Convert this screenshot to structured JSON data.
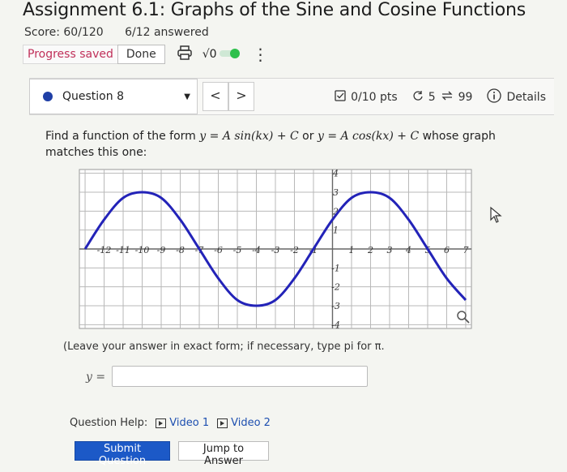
{
  "header": {
    "title": "Assignment 6.1: Graphs of the Sine and Cosine Functions",
    "score": "Score: 60/120",
    "answered": "6/12 answered",
    "progress_saved": "Progress saved",
    "done_label": "Done",
    "sqrt_label": "√0",
    "menu_glyph": "⋮"
  },
  "question_bar": {
    "question_label": "Question 8",
    "prev_glyph": "<",
    "next_glyph": ">",
    "points": "0/10 pts",
    "retries": "5",
    "attempts": "99",
    "details": "Details"
  },
  "question": {
    "prompt_pre": "Find a function of the form",
    "form1": "y = A sin(kx) + C",
    "or": "or",
    "form2": "y = A cos(kx) + C",
    "prompt_post": "whose graph matches this one:",
    "leave_instructions": "(Leave your answer in exact form; if necessary, type pi for π.",
    "answer_prefix": "y =",
    "answer_value": ""
  },
  "help": {
    "label": "Question Help:",
    "video1": "Video 1",
    "video2": "Video 2"
  },
  "actions": {
    "submit": "Submit Question",
    "jump": "Jump to Answer"
  },
  "chart_data": {
    "type": "line",
    "x_ticks": [
      "-12",
      "-11",
      "-10",
      "-9",
      "-8",
      "-7",
      "-6",
      "-5",
      "-4",
      "-3",
      "-2",
      "-1",
      "1",
      "2",
      "3",
      "4",
      "5",
      "6",
      "7"
    ],
    "y_ticks": [
      "4",
      "3",
      "2",
      "1",
      "-1",
      "-2",
      "-3",
      "-4"
    ],
    "xlim": [
      -13.3,
      7.3
    ],
    "ylim": [
      -4.2,
      4.2
    ],
    "grid": true,
    "series": [
      {
        "color": "#2323b8",
        "x": [
          -13,
          -12,
          -11,
          -10,
          -9,
          -8,
          -7,
          -6,
          -5,
          -4,
          -3,
          -2,
          -1,
          0,
          1,
          2,
          3,
          4,
          5,
          6,
          7
        ],
        "y": [
          0,
          1.55,
          2.7,
          3,
          2.7,
          1.55,
          0,
          -1.55,
          -2.7,
          -3,
          -2.7,
          -1.55,
          0,
          1.55,
          2.7,
          3,
          2.7,
          1.55,
          0,
          -1.55,
          -2.7
        ]
      }
    ],
    "colors": {
      "curve": "#2323b8",
      "grid": "#b8b8b8",
      "axis": "#666666"
    }
  },
  "colors": {
    "progress_saved": "#c0305a",
    "accent_blue": "#1c59c7",
    "question_dot": "#1f3fa6",
    "toggle_green": "#2ec04c"
  }
}
